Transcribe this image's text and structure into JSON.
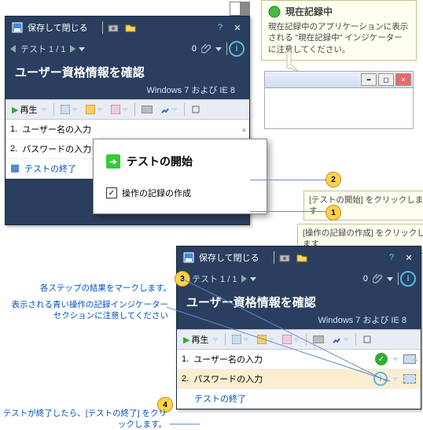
{
  "panel1": {
    "titlebar": {
      "save_close": "保存して閉じる"
    },
    "subbar": {
      "test_counter": "テスト 1 / 1",
      "count": "0"
    },
    "heading": "ユーザー資格情報を確認",
    "subheading": "Windows 7 および IE 8",
    "toolbar": {
      "play": "再生"
    },
    "steps": [
      {
        "num": "1.",
        "label": "ユーザー名の入力"
      },
      {
        "num": "2.",
        "label": "パスワードの入力"
      },
      {
        "num": "",
        "label": "テストの終了"
      }
    ]
  },
  "dialog": {
    "title": "テストの開始",
    "checkbox_label": "操作の記録の作成"
  },
  "recording_callout": {
    "title": "現在記録中",
    "body": "現在記録中のアプリケーションに表示される \"現在記録中\" インジケーターに注意してください。"
  },
  "callouts": {
    "c1": "[操作の記録の作成] をクリックします",
    "c2": "[テストの開始] をクリックします",
    "c3": "各ステップの結果をマークします。",
    "c3b": "表示される青い操作の記録インジケーター セクションに注意してください",
    "c4": "テストが終了したら、[テストの終了] をクリックします。"
  },
  "panel2": {
    "titlebar": {
      "save_close": "保存して閉じる"
    },
    "subbar": {
      "test_counter": "テスト 1 / 1",
      "count": "0"
    },
    "heading": "ユーザー資格情報を確認",
    "subheading": "Windows 7 および IE 8",
    "toolbar": {
      "play": "再生"
    },
    "steps": [
      {
        "num": "1.",
        "label": "ユーザー名の入力"
      },
      {
        "num": "2.",
        "label": "パスワードの入力"
      },
      {
        "num": "",
        "label": "テストの終了"
      }
    ]
  },
  "nums": {
    "n1": "1",
    "n2": "2",
    "n3": "3",
    "n4": "4"
  }
}
